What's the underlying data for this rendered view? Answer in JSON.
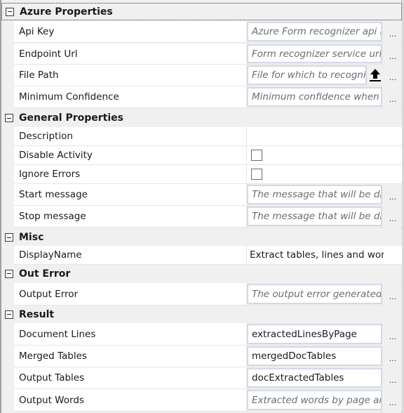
{
  "categories": [
    {
      "name": "Azure Properties",
      "properties": [
        {
          "label": "Api Key",
          "type": "text",
          "value": "",
          "placeholder": "Azure Form recognizer api k",
          "button": "..."
        },
        {
          "label": "Endpoint Url",
          "type": "text",
          "value": "",
          "placeholder": "Form recognizer service url.",
          "button": "..."
        },
        {
          "label": "File Path",
          "type": "file",
          "value": "",
          "placeholder": "File for which to recogniz",
          "icon": "upload-icon",
          "button": "..."
        },
        {
          "label": "Minimum Confidence",
          "type": "text",
          "value": "",
          "placeholder": "Minimum confidence when c",
          "button": "..."
        }
      ]
    },
    {
      "name": "General Properties",
      "properties": [
        {
          "label": "Description",
          "type": "plain",
          "value": ""
        },
        {
          "label": "Disable Activity",
          "type": "checkbox",
          "checked": false
        },
        {
          "label": "Ignore Errors",
          "type": "checkbox",
          "checked": false
        },
        {
          "label": "Start message",
          "type": "text",
          "value": "",
          "placeholder": "The message that will be dis",
          "button": "..."
        },
        {
          "label": "Stop message",
          "type": "text",
          "value": "",
          "placeholder": "The message that will be dis",
          "button": "..."
        }
      ]
    },
    {
      "name": "Misc",
      "properties": [
        {
          "label": "DisplayName",
          "type": "plain",
          "value": "Extract tables, lines and words fro"
        }
      ]
    },
    {
      "name": "Out Error",
      "properties": [
        {
          "label": "Output Error",
          "type": "text",
          "value": "",
          "placeholder": "The output error generated i",
          "button": "..."
        }
      ]
    },
    {
      "name": "Result",
      "properties": [
        {
          "label": "Document Lines",
          "type": "text",
          "value": "extractedLinesByPage",
          "placeholder": "",
          "button": "..."
        },
        {
          "label": "Merged Tables",
          "type": "text",
          "value": "mergedDocTables",
          "placeholder": "",
          "button": "..."
        },
        {
          "label": "Output Tables",
          "type": "text",
          "value": "docExtractedTables",
          "placeholder": "",
          "button": "..."
        },
        {
          "label": "Output Words",
          "type": "text",
          "value": "",
          "placeholder": "Extracted words by page anc",
          "button": "..."
        }
      ]
    }
  ]
}
